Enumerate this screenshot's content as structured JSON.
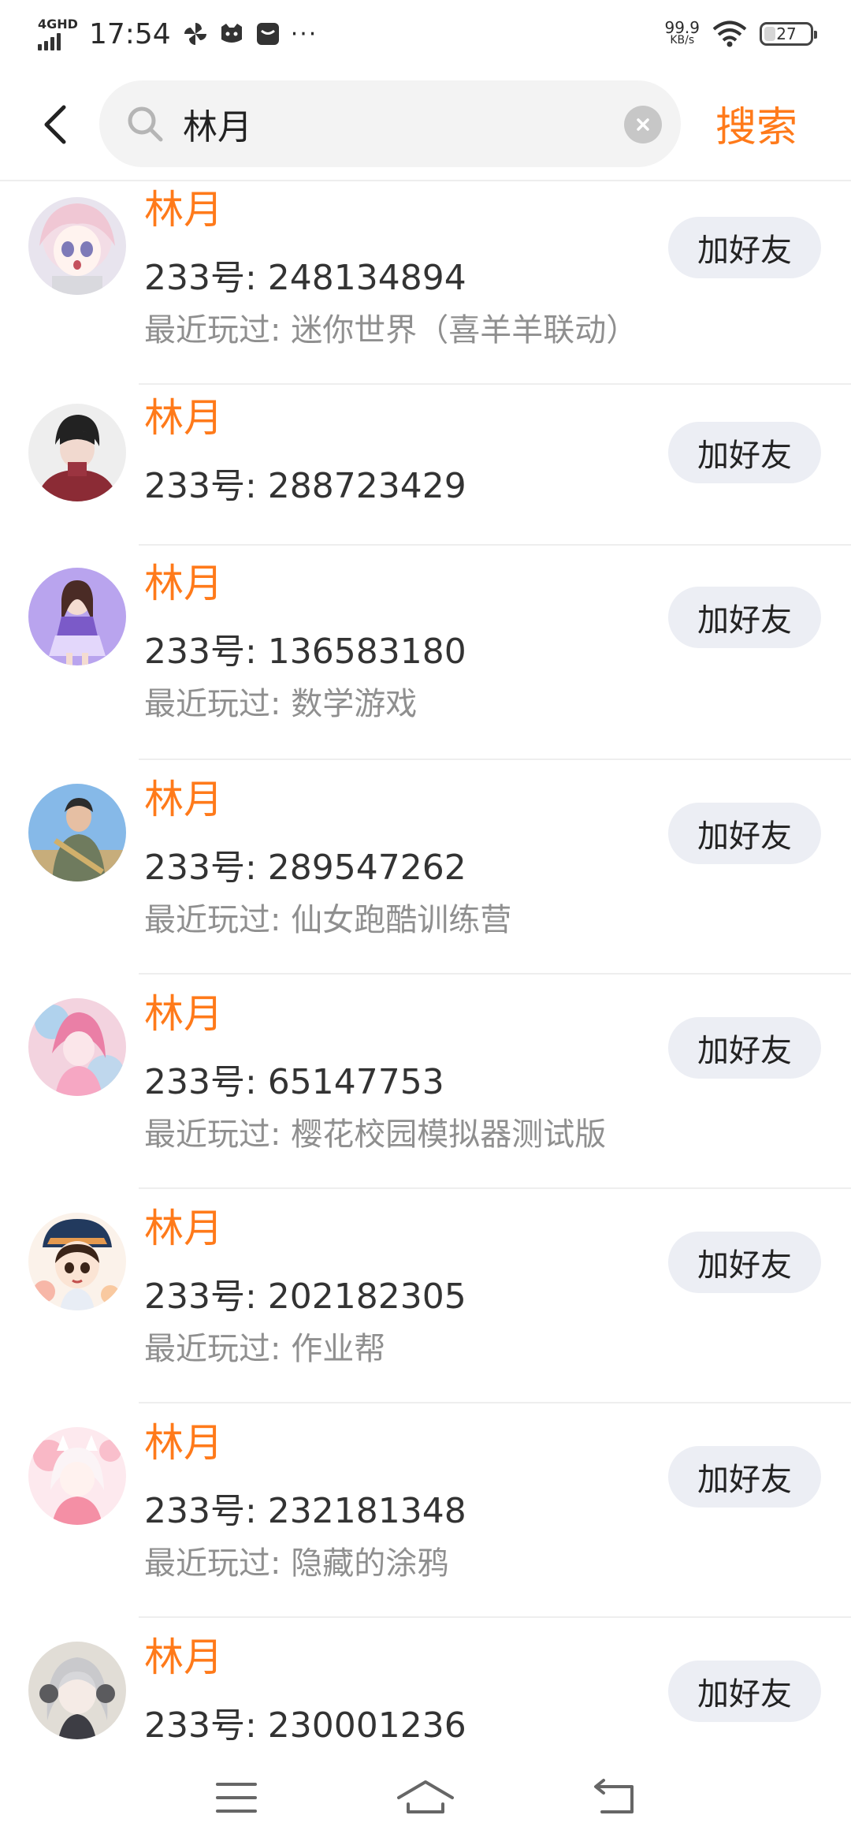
{
  "status_bar": {
    "network": "4GHD",
    "time": "17:54",
    "speed_value": "99.9",
    "speed_unit": "KB/s",
    "battery_level": "27",
    "more": "···"
  },
  "header": {
    "search_query": "林月",
    "search_button": "搜索"
  },
  "colors": {
    "accent": "#ff7a1a",
    "button_bg": "#eceef4"
  },
  "results": [
    {
      "name": "林月",
      "id_line": "233号: 248134894",
      "played": "最近玩过: 迷你世界（喜羊羊联动）",
      "button": "加好友"
    },
    {
      "name": "林月",
      "id_line": "233号: 288723429",
      "played": "",
      "button": "加好友"
    },
    {
      "name": "林月",
      "id_line": "233号: 136583180",
      "played": "最近玩过: 数学游戏",
      "button": "加好友"
    },
    {
      "name": "林月",
      "id_line": "233号: 289547262",
      "played": "最近玩过: 仙女跑酷训练营",
      "button": "加好友"
    },
    {
      "name": "林月",
      "id_line": "233号: 65147753",
      "played": "最近玩过: 樱花校园模拟器测试版",
      "button": "加好友"
    },
    {
      "name": "林月",
      "id_line": "233号: 202182305",
      "played": "最近玩过: 作业帮",
      "button": "加好友"
    },
    {
      "name": "林月",
      "id_line": "233号: 232181348",
      "played": "最近玩过: 隐藏的涂鸦",
      "button": "加好友"
    },
    {
      "name": "林月",
      "id_line": "233号: 230001236",
      "played": "",
      "button": "加好友"
    }
  ],
  "nav": {
    "menu_icon": "menu-icon",
    "home_icon": "home-icon",
    "back_icon": "back-icon"
  }
}
